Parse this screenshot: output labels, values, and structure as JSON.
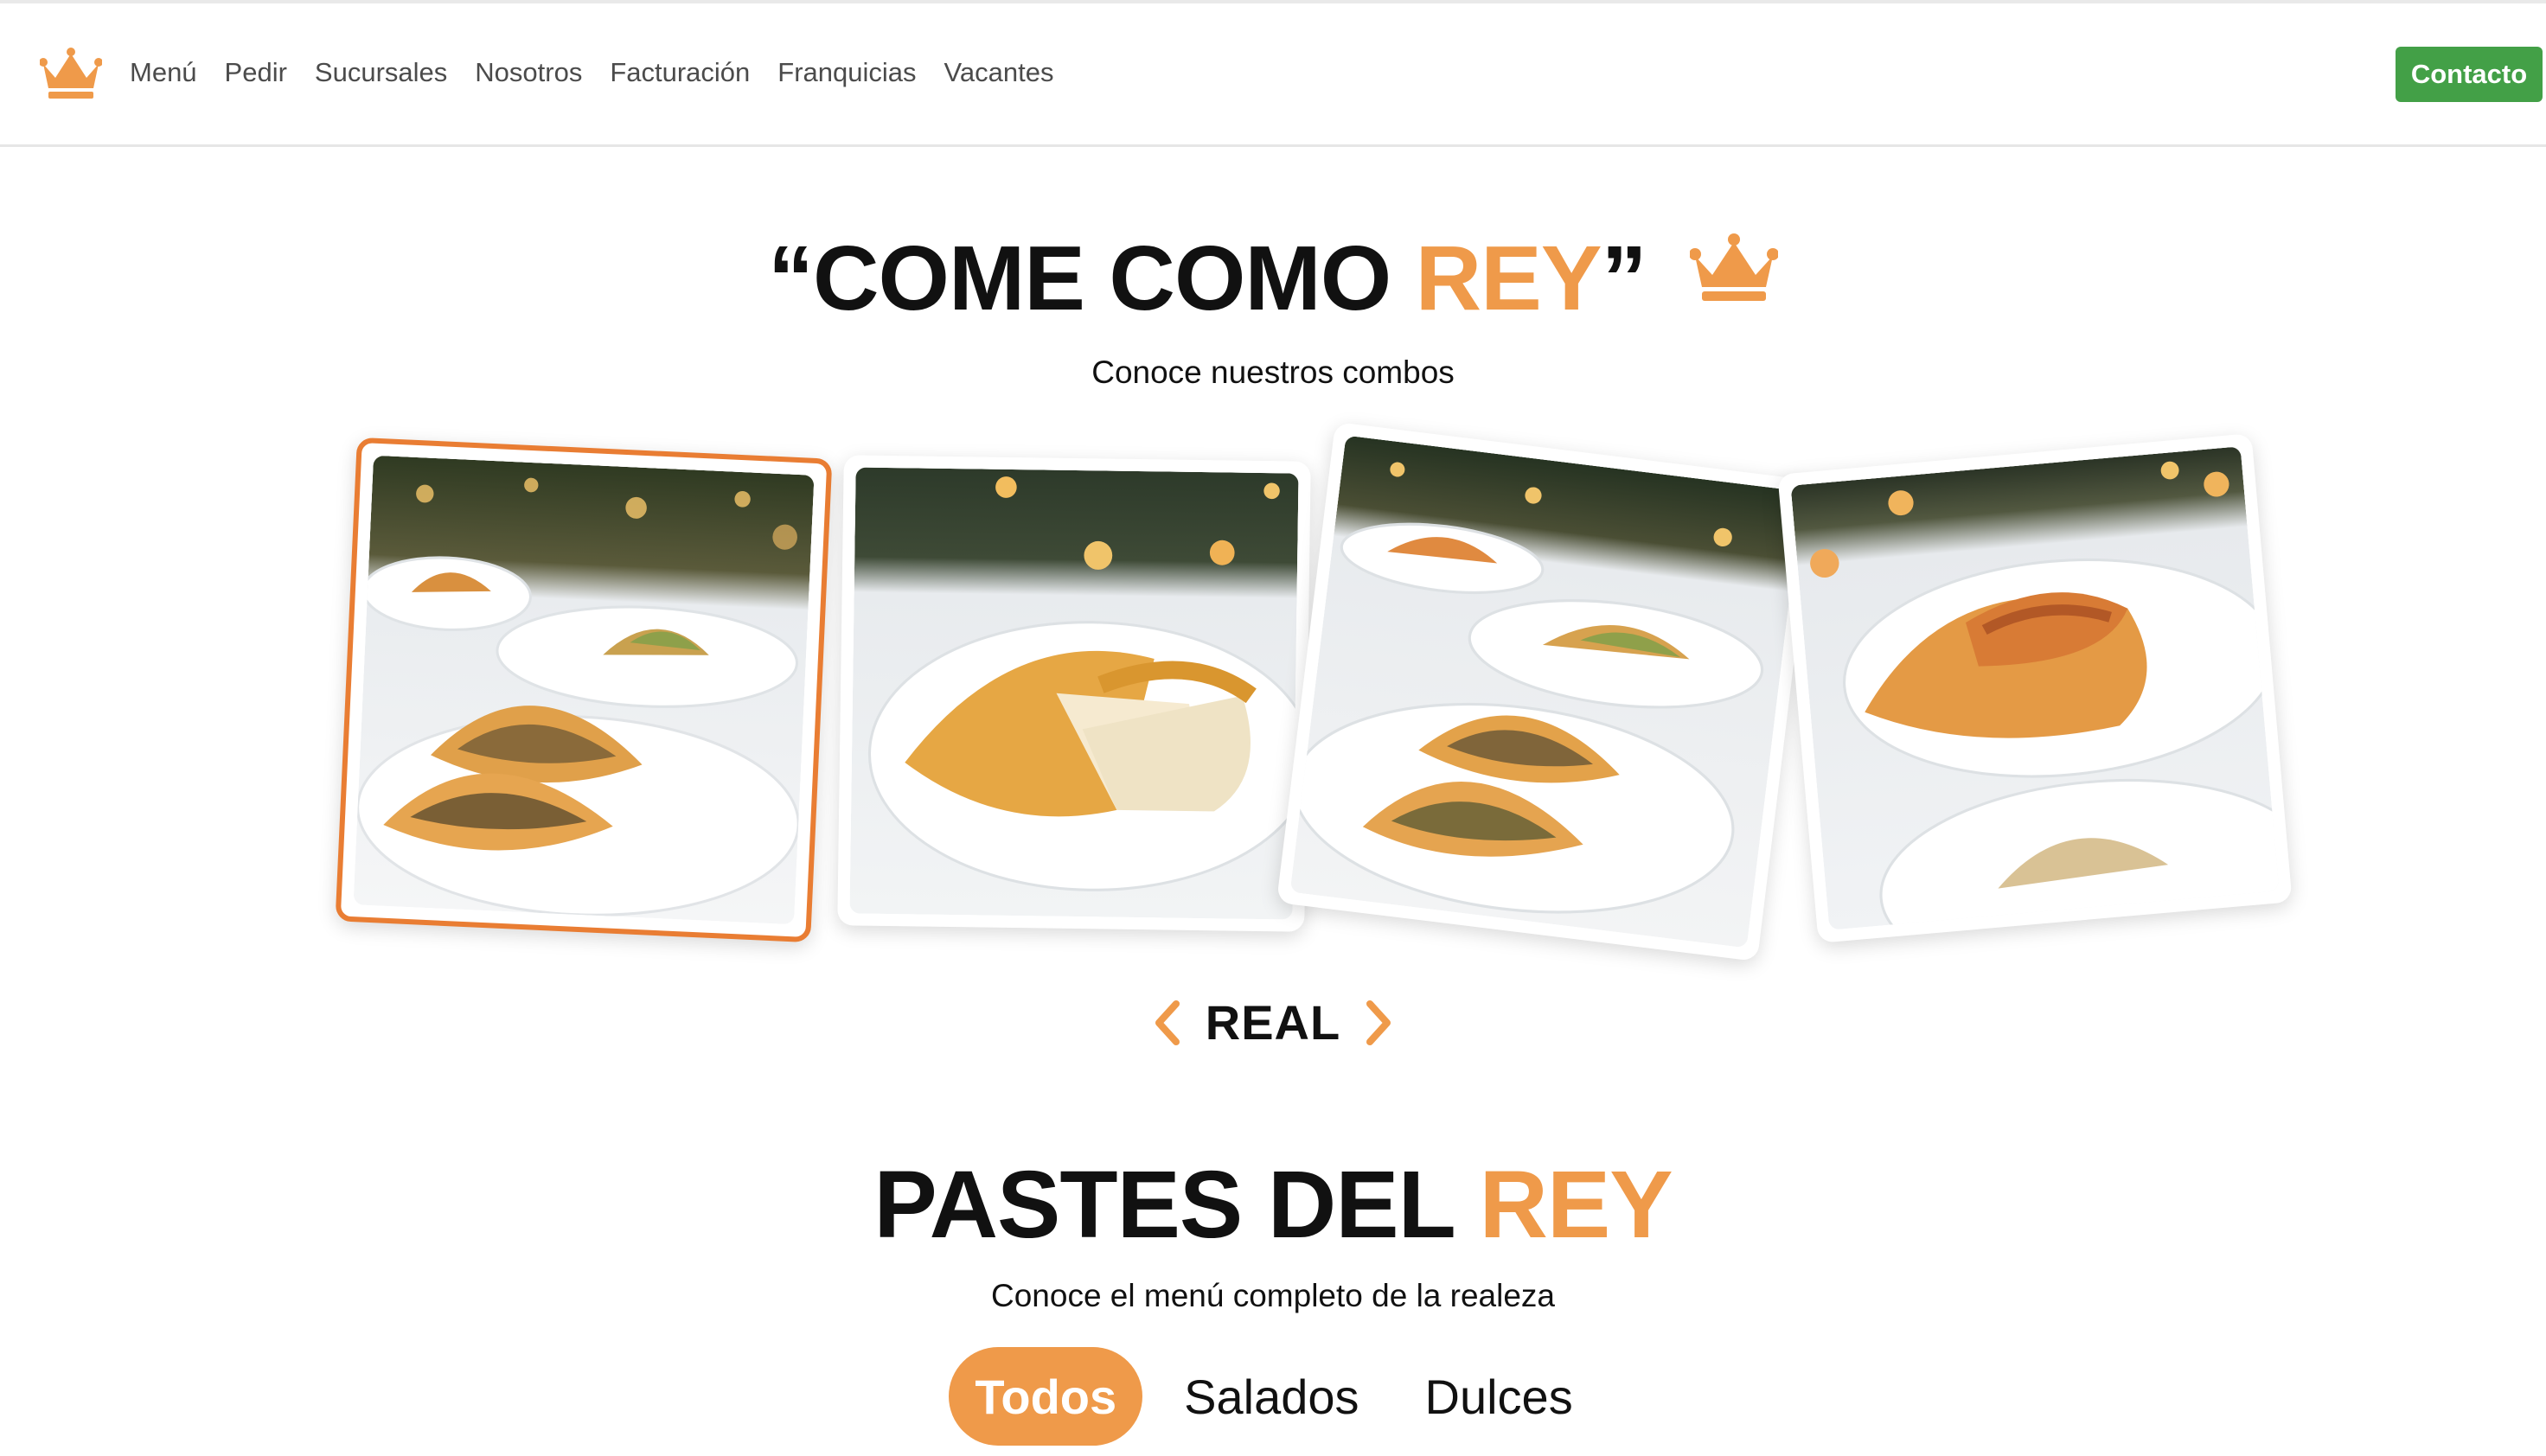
{
  "nav": {
    "logo_icon": "crown-icon",
    "links": [
      "Menú",
      "Pedir",
      "Sucursales",
      "Nosotros",
      "Facturación",
      "Franquicias",
      "Vacantes"
    ],
    "contact_label": "Contacto",
    "contact_color": "#43a047"
  },
  "hero": {
    "title_main": "“COME COMO ",
    "title_accent": "REY",
    "title_end": "”",
    "title_icon": "crown-icon",
    "subtitle": "Conoce nuestros combos",
    "accent_color": "#ef9a4a"
  },
  "carousel": {
    "label": "REAL",
    "prev_icon": "chevron-left-icon",
    "next_icon": "chevron-right-icon",
    "active_index": 0,
    "active_border_color": "#e97d33",
    "slides": [
      {
        "image": "pastes-ground-meat-on-plate-photo"
      },
      {
        "image": "paste-cut-in-half-on-plate-photo"
      },
      {
        "image": "pastes-assorted-plates-photo"
      },
      {
        "image": "paste-shredded-chicken-on-plate-photo"
      }
    ]
  },
  "menu": {
    "title_main": "PASTES DEL ",
    "title_accent": "REY",
    "subtitle": "Conoce el menú completo de la realeza",
    "filters": [
      "Todos",
      "Salados",
      "Dulces"
    ],
    "active_filter": "Todos"
  }
}
